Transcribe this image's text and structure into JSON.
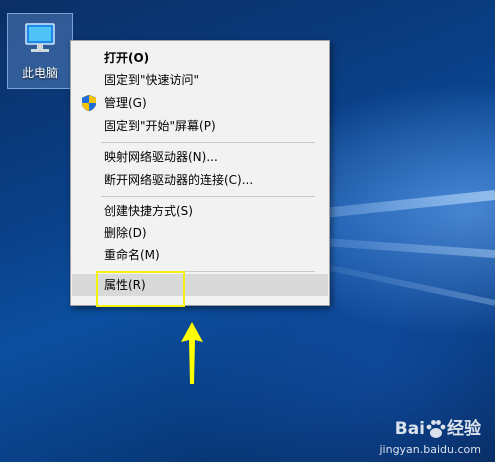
{
  "desktop": {
    "icon_label": "此电脑"
  },
  "context_menu": {
    "items": [
      {
        "label": "打开(O)",
        "bold": true
      },
      {
        "label": "固定到\"快速访问\""
      },
      {
        "label": "管理(G)",
        "icon": "uac-shield-icon"
      },
      {
        "label": "固定到\"开始\"屏幕(P)"
      },
      {
        "label": "映射网络驱动器(N)..."
      },
      {
        "label": "断开网络驱动器的连接(C)..."
      },
      {
        "label": "创建快捷方式(S)"
      },
      {
        "label": "删除(D)"
      },
      {
        "label": "重命名(M)"
      },
      {
        "label": "属性(R)",
        "selected": true
      }
    ]
  },
  "annotation": {
    "highlight_color": "#f2f20a",
    "arrow_color": "#ffff00"
  },
  "watermark": {
    "brand": "Bai",
    "brand_suffix": "经验",
    "url": "jingyan.baidu.com"
  }
}
